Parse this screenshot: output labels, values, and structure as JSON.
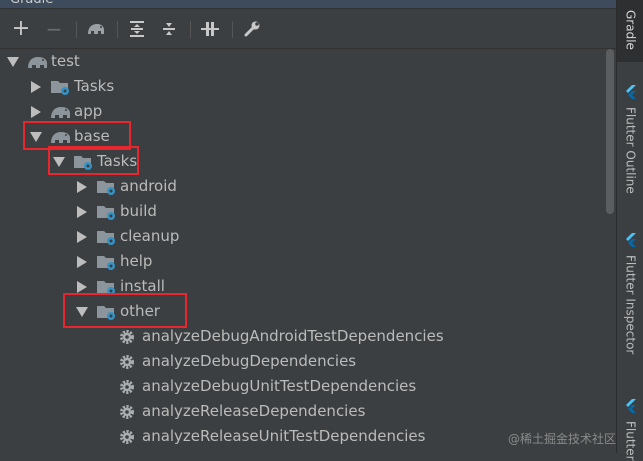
{
  "window": {
    "title": "Gradle"
  },
  "toolbar": {
    "add": "+",
    "remove": "−"
  },
  "tree": {
    "items": [
      {
        "label": "test",
        "icon": "elephant-icon",
        "expanded": true
      },
      {
        "label": "Tasks",
        "icon": "task-folder-icon",
        "expanded": false
      },
      {
        "label": "app",
        "icon": "elephant-icon",
        "expanded": false
      },
      {
        "label": "base",
        "icon": "elephant-icon",
        "expanded": true
      },
      {
        "label": "Tasks",
        "icon": "task-folder-icon",
        "expanded": true
      },
      {
        "label": "android",
        "icon": "task-folder-icon",
        "expanded": false
      },
      {
        "label": "build",
        "icon": "task-folder-icon",
        "expanded": false
      },
      {
        "label": "cleanup",
        "icon": "task-folder-icon",
        "expanded": false
      },
      {
        "label": "help",
        "icon": "task-folder-icon",
        "expanded": false
      },
      {
        "label": "install",
        "icon": "task-folder-icon",
        "expanded": false
      },
      {
        "label": "other",
        "icon": "task-folder-icon",
        "expanded": true
      },
      {
        "label": "analyzeDebugAndroidTestDependencies",
        "icon": "gear-icon"
      },
      {
        "label": "analyzeDebugDependencies",
        "icon": "gear-icon"
      },
      {
        "label": "analyzeDebugUnitTestDependencies",
        "icon": "gear-icon"
      },
      {
        "label": "analyzeReleaseDependencies",
        "icon": "gear-icon"
      },
      {
        "label": "analyzeReleaseUnitTestDependencies",
        "icon": "gear-icon"
      }
    ]
  },
  "right_tabs": [
    {
      "label": "Gradle"
    },
    {
      "label": "Flutter Outline"
    },
    {
      "label": "Flutter Inspector"
    },
    {
      "label": "Flutter"
    }
  ],
  "watermark": "@稀土掘金技术社区",
  "colors": {
    "highlight": "#e8262e",
    "accent": "#3592c4",
    "background": "#3c3f41"
  }
}
